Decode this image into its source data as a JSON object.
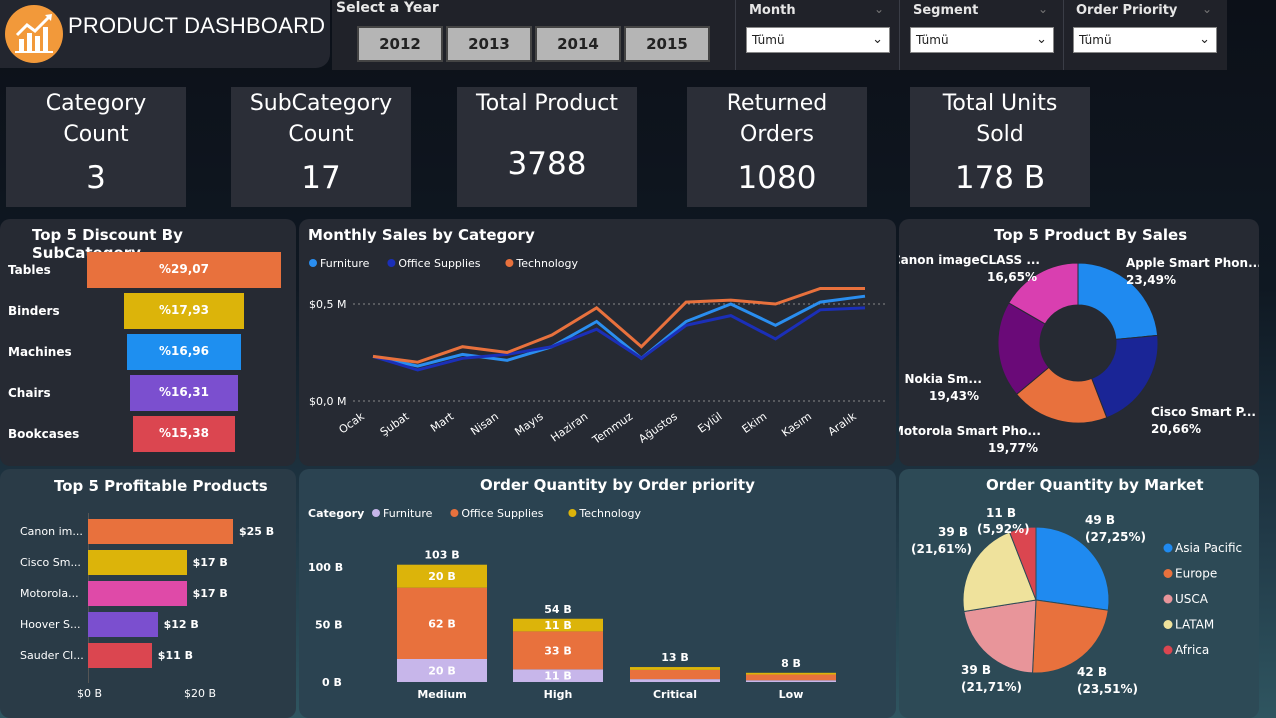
{
  "header": {
    "title": "PRODUCT DASHBOARD",
    "year_title": "Select a Year",
    "years": [
      "2012",
      "2013",
      "2014",
      "2015"
    ],
    "month_label": "Month",
    "segment_label": "Segment",
    "priority_label": "Order Priority",
    "month_value": "Tümü",
    "segment_value": "Tümü",
    "priority_value": "Tümü"
  },
  "kpis": [
    {
      "label1": "Category",
      "label2": "Count",
      "value": "3"
    },
    {
      "label1": "SubCategory",
      "label2": "Count",
      "value": "17"
    },
    {
      "label1": "Total Product",
      "label2": "",
      "value": "3788"
    },
    {
      "label1": "Returned",
      "label2": "Orders",
      "value": "1080"
    },
    {
      "label1": "Total Units",
      "label2": "Sold",
      "value": "178 B"
    }
  ],
  "discount": {
    "title": "Top 5 Discount By SubCategory",
    "rows": [
      {
        "name": "Tables",
        "label": "%29,07",
        "value": 29.07,
        "color": "#e8713d"
      },
      {
        "name": "Binders",
        "label": "%17,93",
        "value": 17.93,
        "color": "#dcb40a"
      },
      {
        "name": "Machines",
        "label": "%16,96",
        "value": 16.96,
        "color": "#1e8ff0"
      },
      {
        "name": "Chairs",
        "label": "%16,31",
        "value": 16.31,
        "color": "#7b4fcf"
      },
      {
        "name": "Bookcases",
        "label": "%15,38",
        "value": 15.38,
        "color": "#db4650"
      }
    ]
  },
  "monthly": {
    "title": "Monthly Sales by Category",
    "y_ticks": [
      "$0,5 M",
      "$0,0 M"
    ],
    "categories": [
      "Ocak",
      "Şubat",
      "Mart",
      "Nisan",
      "Mayıs",
      "Haziran",
      "Temmuz",
      "Ağustos",
      "Eylül",
      "Ekim",
      "Kasım",
      "Aralık"
    ],
    "series": [
      {
        "name": "Furniture",
        "color": "#2a8ef0",
        "values": [
          0.23,
          0.18,
          0.24,
          0.21,
          0.28,
          0.41,
          0.22,
          0.41,
          0.5,
          0.39,
          0.51,
          0.54
        ]
      },
      {
        "name": "Office Supplies",
        "color": "#1b2fb8",
        "values": [
          0.23,
          0.16,
          0.22,
          0.24,
          0.28,
          0.37,
          0.22,
          0.39,
          0.44,
          0.32,
          0.47,
          0.48
        ]
      },
      {
        "name": "Technology",
        "color": "#e8713d",
        "values": [
          0.23,
          0.2,
          0.28,
          0.25,
          0.34,
          0.48,
          0.28,
          0.51,
          0.52,
          0.5,
          0.58,
          0.58
        ]
      }
    ],
    "ylim": [
      0,
      0.5
    ]
  },
  "top_sales": {
    "title": "Top 5 Product By Sales",
    "slices": [
      {
        "name": "Apple Smart Phon...",
        "pct": "23,49%",
        "value": 23.49,
        "color": "#1f8af0"
      },
      {
        "name": "Cisco Smart P...",
        "pct": "20,66%",
        "value": 20.66,
        "color": "#1a2596"
      },
      {
        "name": "Motorola Smart Pho...",
        "pct": "19,77%",
        "value": 19.77,
        "color": "#e8713d"
      },
      {
        "name": "Nokia Sm...",
        "pct": "19,43%",
        "value": 19.43,
        "color": "#6a0a78"
      },
      {
        "name": "Canon imageCLASS ...",
        "pct": "16,65%",
        "value": 16.65,
        "color": "#d93fb0"
      }
    ]
  },
  "profitable": {
    "title": "Top 5 Profitable Products",
    "x_ticks": [
      "$0 B",
      "$20 B"
    ],
    "rows": [
      {
        "name": "Canon im...",
        "label": "$25 B",
        "value": 25,
        "color": "#e8713d"
      },
      {
        "name": "Cisco Sm...",
        "label": "$17 B",
        "value": 17,
        "color": "#dcb40a"
      },
      {
        "name": "Motorola...",
        "label": "$17 B",
        "value": 17,
        "color": "#df4aa8"
      },
      {
        "name": "Hoover S...",
        "label": "$12 B",
        "value": 12,
        "color": "#7b4fcf"
      },
      {
        "name": "Sauder Cl...",
        "label": "$11 B",
        "value": 11,
        "color": "#db4650"
      }
    ]
  },
  "priority": {
    "title": "Order Quantity by Order priority",
    "legend_title": "Category",
    "legend": [
      {
        "name": "Furniture",
        "color": "#c7b6ea"
      },
      {
        "name": "Office Supplies",
        "color": "#e8713d"
      },
      {
        "name": "Technology",
        "color": "#dcb40a"
      }
    ],
    "y_ticks": [
      "100 B",
      "50 B",
      "0 B"
    ],
    "ylim": [
      0,
      100
    ],
    "bars": [
      {
        "name": "Medium",
        "total": "103 B",
        "furniture": 20,
        "office": 62,
        "tech": 20,
        "f_label": "20 B",
        "o_label": "62 B",
        "t_label": "20 B"
      },
      {
        "name": "High",
        "total": "54 B",
        "furniture": 11,
        "office": 33,
        "tech": 11,
        "f_label": "11 B",
        "o_label": "33 B",
        "t_label": "11 B"
      },
      {
        "name": "Critical",
        "total": "13 B",
        "furniture": 2.5,
        "office": 8,
        "tech": 2.5,
        "f_label": "",
        "o_label": "",
        "t_label": ""
      },
      {
        "name": "Low",
        "total": "8 B",
        "furniture": 1.5,
        "office": 5,
        "tech": 1.5,
        "f_label": "",
        "o_label": "",
        "t_label": ""
      }
    ]
  },
  "market": {
    "title": "Order Quantity by Market",
    "slices": [
      {
        "name": "Asia Pacific",
        "value_label": "49 B",
        "pct": "(27,25%)",
        "value": 27.25,
        "color": "#1f8af0"
      },
      {
        "name": "Europe",
        "value_label": "42 B",
        "pct": "(23,51%)",
        "value": 23.51,
        "color": "#e8713d"
      },
      {
        "name": "USCA",
        "value_label": "39 B",
        "pct": "(21,71%)",
        "value": 21.71,
        "color": "#e8959a"
      },
      {
        "name": "LATAM",
        "value_label": "39 B",
        "pct": "(21,61%)",
        "value": 21.61,
        "color": "#efe29c"
      },
      {
        "name": "Africa",
        "value_label": "11 B",
        "pct": "(5,92%)",
        "value": 5.92,
        "color": "#db4650"
      }
    ]
  }
}
